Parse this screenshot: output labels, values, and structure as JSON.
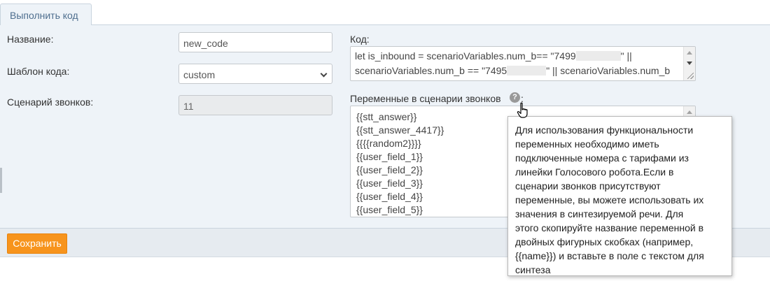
{
  "tab": {
    "label": "Выполнить код"
  },
  "form": {
    "name_label": "Название:",
    "name_value": "new_code",
    "template_label": "Шаблон кода:",
    "template_value": "custom",
    "scenario_label": "Сценарий звонков:",
    "scenario_value": "11",
    "code_label": "Код:",
    "code_lines": [
      {
        "before": "let is_inbound = scenarioVariables.num_b== \"7499",
        "after": "\" ||"
      },
      {
        "before": "scenarioVariables.num_b == \"7495",
        "after": "\" || scenarioVariables.num_b"
      }
    ],
    "variables_label": "Переменные в сценарии звонков",
    "variables_after": ":",
    "variables": [
      "{{stt_answer}}",
      "{{stt_answer_4417}}",
      "{{{{random2}}}}",
      "{{user_field_1}}",
      "{{user_field_2}}",
      "{{user_field_3}}",
      "{{user_field_4}}",
      "{{user_field_5}}"
    ]
  },
  "help": {
    "icon_glyph": "?",
    "tooltip_lines": [
      "Для использования функциональности",
      "переменных необходимо иметь",
      "подключенные номера с тарифами из",
      "линейки Голосового робота.Если в",
      "сценарии звонков присутствуют",
      "переменные, вы можете использовать их",
      "значения в синтезируемой речи. Для",
      "этого скопируйте название переменной в",
      "двойных фигурных скобках (например,",
      "{{name}}) и вставьте в поле с текстом для",
      "синтеза"
    ]
  },
  "footer": {
    "save_label": "Сохранить"
  },
  "colors": {
    "accent": "#f7941d",
    "panel": "#eef3f8"
  }
}
